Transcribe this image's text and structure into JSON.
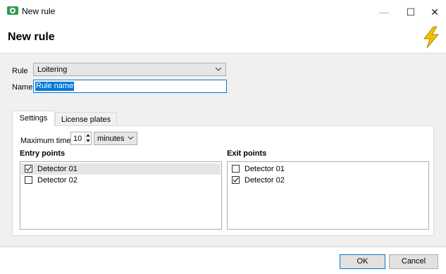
{
  "window": {
    "title": "New rule",
    "minimize_glyph": "—",
    "maximize_glyph": "☐",
    "close_glyph": "✕"
  },
  "header": {
    "title": "New rule",
    "icon": "lightning-bolt-icon",
    "icon_color": "#f2c200"
  },
  "form": {
    "rule_label": "Rule",
    "rule_value": "Loitering",
    "name_label": "Name",
    "name_value": "Rule name"
  },
  "tabs": [
    {
      "label": "Settings",
      "active": true
    },
    {
      "label": "License plates",
      "active": false
    }
  ],
  "settings": {
    "max_time_label": "Maximum time",
    "max_time_value": "10",
    "unit_value": "minutes",
    "entry_heading": "Entry points",
    "exit_heading": "Exit points",
    "entry_points": [
      {
        "label": "Detector 01",
        "checked": true,
        "selected": true
      },
      {
        "label": "Detector 02",
        "checked": false,
        "selected": false
      }
    ],
    "exit_points": [
      {
        "label": "Detector 01",
        "checked": false,
        "selected": false
      },
      {
        "label": "Detector 02",
        "checked": true,
        "selected": false
      }
    ]
  },
  "footer": {
    "ok_label": "OK",
    "cancel_label": "Cancel"
  },
  "colors": {
    "accent": "#0078d7",
    "app_icon": "#2e9c4c"
  }
}
